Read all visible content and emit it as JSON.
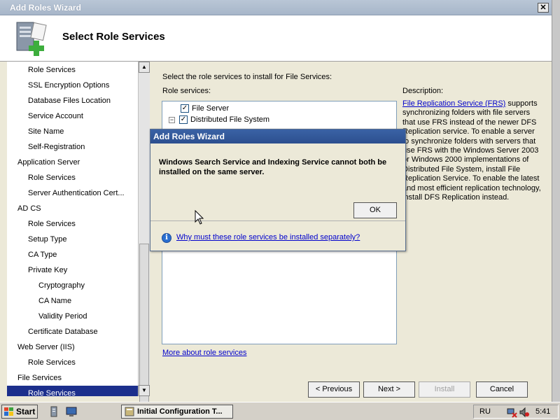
{
  "window": {
    "title": "Add Roles Wizard",
    "close_label": "✕"
  },
  "header": {
    "title": "Select Role Services"
  },
  "nav": {
    "items": [
      {
        "label": "Role Services",
        "indent": 1
      },
      {
        "label": "SSL Encryption Options",
        "indent": 1
      },
      {
        "label": "Database Files Location",
        "indent": 1
      },
      {
        "label": "Service Account",
        "indent": 1
      },
      {
        "label": "Site Name",
        "indent": 1
      },
      {
        "label": "Self-Registration",
        "indent": 1
      },
      {
        "label": "Application Server",
        "indent": 0
      },
      {
        "label": "Role Services",
        "indent": 1
      },
      {
        "label": "Server Authentication Cert...",
        "indent": 1
      },
      {
        "label": "AD CS",
        "indent": 0
      },
      {
        "label": "Role Services",
        "indent": 1
      },
      {
        "label": "Setup Type",
        "indent": 1
      },
      {
        "label": "CA Type",
        "indent": 1
      },
      {
        "label": "Private Key",
        "indent": 1
      },
      {
        "label": "Cryptography",
        "indent": 2
      },
      {
        "label": "CA Name",
        "indent": 2
      },
      {
        "label": "Validity Period",
        "indent": 2
      },
      {
        "label": "Certificate Database",
        "indent": 1
      },
      {
        "label": "Web Server (IIS)",
        "indent": 0
      },
      {
        "label": "Role Services",
        "indent": 1
      },
      {
        "label": "File Services",
        "indent": 0
      },
      {
        "label": "Role Services",
        "indent": 1,
        "selected": true
      }
    ]
  },
  "content": {
    "prompt": "Select the role services to install for File Services:",
    "role_services_label": "Role services:",
    "tree": [
      {
        "label": "File Server",
        "checked": true,
        "expander": ""
      },
      {
        "label": "Distributed File System",
        "checked": true,
        "expander": "−"
      }
    ],
    "description_label": "Description:",
    "description_link": "File Replication Service (FRS)",
    "description_text": " supports synchronizing folders with file servers that use FRS instead of the newer DFS Replication service. To enable a server to synchronize folders with servers that use FRS with the Windows Server 2003 or Windows 2000 implementations of Distributed File System, install File Replication Service. To enable the latest and most efficient replication technology, install DFS Replication instead.",
    "more_link": "More about role services"
  },
  "buttons": {
    "previous": "< Previous",
    "next": "Next >",
    "install": "Install",
    "cancel": "Cancel"
  },
  "dialog": {
    "title": "Add Roles Wizard",
    "message": "Windows Search Service and Indexing Service cannot both be installed on the same server.",
    "ok": "OK",
    "help_link": "Why must these role services be installed separately?",
    "info_glyph": "i"
  },
  "taskbar": {
    "start": "Start",
    "task": "Initial Configuration T...",
    "language": "RU",
    "clock": "5:41"
  },
  "colors": {
    "selection": "#1c2f8c",
    "dialog_title": "#2c4f8f",
    "link": "#0000cc"
  }
}
